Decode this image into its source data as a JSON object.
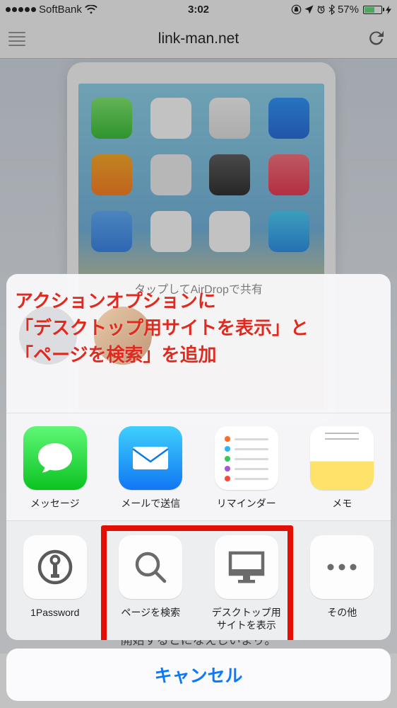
{
  "status": {
    "carrier": "SoftBank",
    "time": "3:02",
    "battery_pct": "57%"
  },
  "safari": {
    "url": "link-man.net"
  },
  "page_footer": "開始するとになえしいまり。",
  "sheet": {
    "airdrop_title": "タップしてAirDropで共有",
    "annotation_l1": "アクションオプションに",
    "annotation_l2": "「デスクトップ用サイトを表示」と",
    "annotation_l3": "「ページを検索」を追加",
    "apps": {
      "messages": "メッセージ",
      "mail": "メールで送信",
      "reminders": "リマインダー",
      "notes": "メモ"
    },
    "actions": {
      "onepassword": "1Password",
      "find_on_page": "ページを検索",
      "desktop_site_l1": "デスクトップ用",
      "desktop_site_l2": "サイトを表示",
      "more": "その他"
    },
    "cancel": "キャンセル"
  }
}
